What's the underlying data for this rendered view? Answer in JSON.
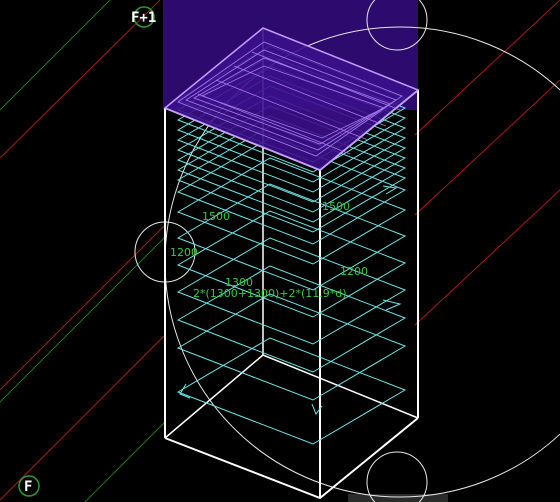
{
  "viewport": {
    "background_color": "#000000"
  },
  "colors": {
    "box_edge": "#ffffff",
    "rebar": "#6ee7e7",
    "top_plate_fill": "#3b0f8a",
    "top_plate_edge": "#c49bff",
    "top_panel_fill": "#2c0a6e",
    "dimension_text": "#39c83f",
    "grid_red": "#b01818",
    "grid_green": "#1e7a1e",
    "snap_circle": "#e8e8e8",
    "level_marker": "#ffffff",
    "level_marker_ring": "#2e9a2e"
  },
  "level_markers": {
    "top": "F+1",
    "bottom": "F"
  },
  "dimensions": {
    "d1": "1500",
    "d2": "1500",
    "d3": "1200",
    "d4": "1200",
    "d5": "1300",
    "formula": "2*(1300+1300)+2*(11.9*d)"
  }
}
